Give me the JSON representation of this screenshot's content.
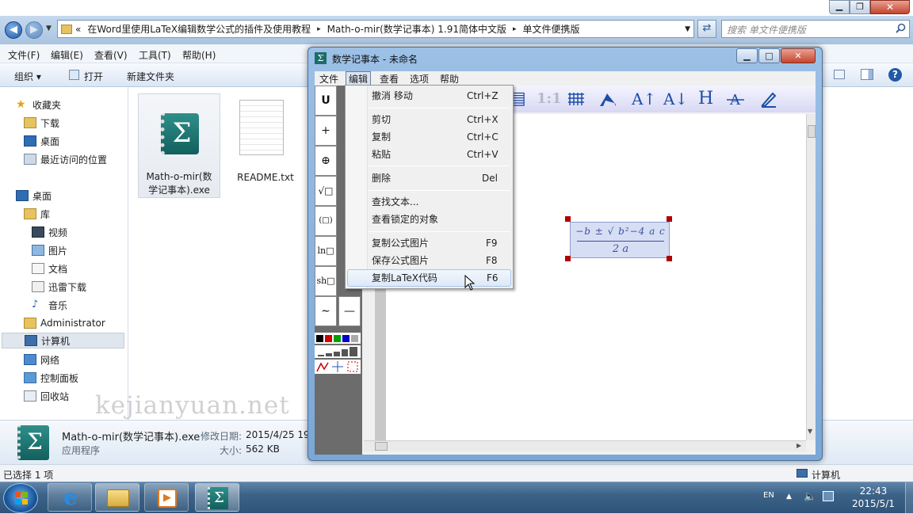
{
  "explorer": {
    "address_parts": [
      "«",
      "在Word里使用LaTeX编辑数学公式的插件及使用教程",
      "▸",
      "Math-o-mir(数学记事本) 1.91简体中文版",
      "▸",
      "单文件便携版"
    ],
    "search_placeholder": "搜索 单文件便携版",
    "menu": [
      "文件(F)",
      "编辑(E)",
      "查看(V)",
      "工具(T)",
      "帮助(H)"
    ],
    "commands": {
      "organize": "组织 ▾",
      "open": "打开",
      "new_folder": "新建文件夹"
    },
    "nav": {
      "favorites": "收藏夹",
      "downloads": "下载",
      "desktop_fav": "桌面",
      "recent": "最近访问的位置",
      "desktop": "桌面",
      "libraries": "库",
      "videos": "视频",
      "pictures": "图片",
      "documents": "文档",
      "thunder": "迅雷下载",
      "music": "音乐",
      "admin": "Administrator",
      "computer": "计算机",
      "network": "网络",
      "control_panel": "控制面板",
      "recycle": "回收站"
    },
    "files": {
      "exe_line1": "Math-o-mir(数",
      "exe_line2": "学记事本).exe",
      "readme": "README.txt"
    },
    "watermark": "kejianyuan.net",
    "details": {
      "name": "Math-o-mir(数学记事本).exe",
      "modified_label": "修改日期:",
      "modified_value": "2015/4/25 19:",
      "type": "应用程序",
      "size_label": "大小:",
      "size_value": "562 KB"
    },
    "status": {
      "selected": "已选择 1 项",
      "location": "计算机"
    }
  },
  "math_window": {
    "title": "数学记事本 - 未命名",
    "menu": [
      "文件",
      "编辑",
      "查看",
      "选项",
      "帮助"
    ],
    "palette": [
      "U",
      "+",
      "⊕",
      "√□",
      "(□)",
      "ln□",
      "sh□",
      "∼",
      "—"
    ],
    "toolbar": [
      "1:1",
      "A↑",
      "A↓",
      "H"
    ],
    "formula": {
      "numerator": "−b ± √ b²−4 a c",
      "denominator": "2 a"
    }
  },
  "edit_menu": {
    "items": [
      {
        "label": "撤消 移动",
        "shortcut": "Ctrl+Z"
      },
      {
        "label": "剪切",
        "shortcut": "Ctrl+X"
      },
      {
        "label": "复制",
        "shortcut": "Ctrl+C"
      },
      {
        "label": "粘贴",
        "shortcut": "Ctrl+V"
      },
      {
        "label": "删除",
        "shortcut": "Del"
      },
      {
        "label": "查找文本...",
        "shortcut": ""
      },
      {
        "label": "查看锁定的对象",
        "shortcut": ""
      },
      {
        "label": "复制公式图片",
        "shortcut": "F9"
      },
      {
        "label": "保存公式图片",
        "shortcut": "F8"
      },
      {
        "label": "复制LaTeX代码",
        "shortcut": "F6"
      }
    ]
  },
  "taskbar": {
    "lang": "EN",
    "time": "22:43",
    "date": "2015/5/1"
  },
  "colors": {
    "accent": "#1d4fa6",
    "formula_fill": "#d6def4",
    "handle": "#b00000",
    "taskbar": "#3c6288"
  }
}
